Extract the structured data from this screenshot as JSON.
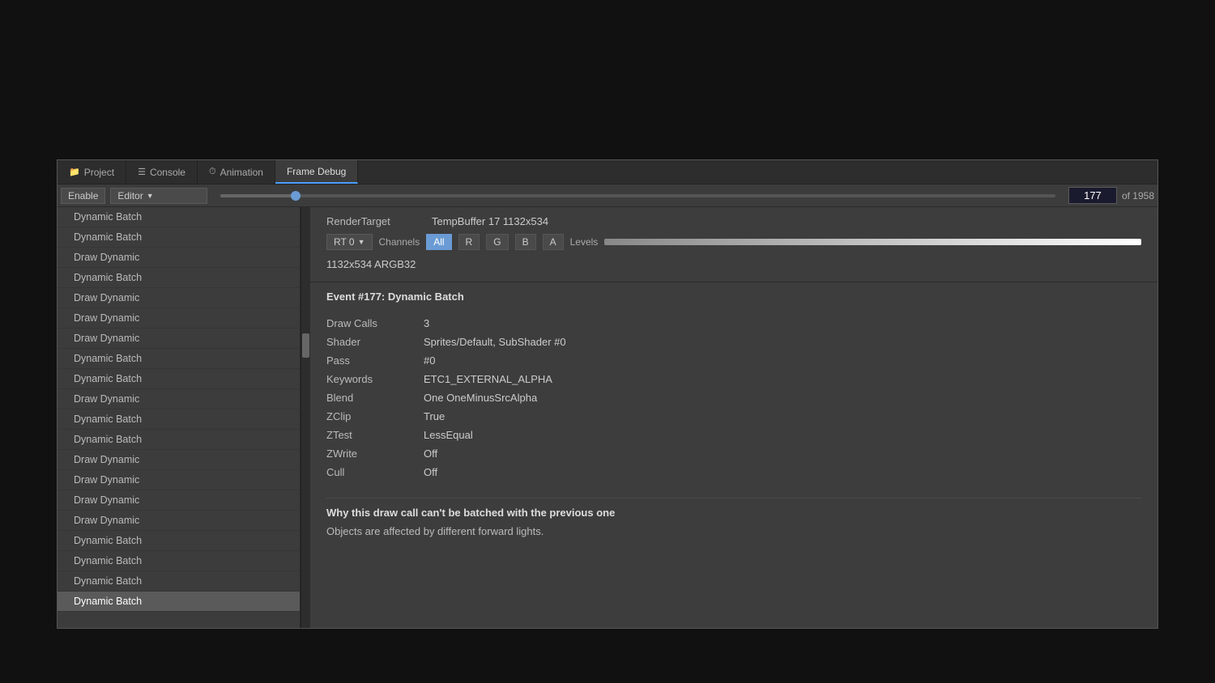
{
  "tabs": [
    {
      "id": "project",
      "label": "Project",
      "icon": "📁",
      "active": false
    },
    {
      "id": "console",
      "label": "Console",
      "icon": "☰",
      "active": false
    },
    {
      "id": "animation",
      "label": "Animation",
      "icon": "⏱",
      "active": false
    },
    {
      "id": "frame-debug",
      "label": "Frame Debug",
      "icon": "",
      "active": true
    }
  ],
  "toolbar": {
    "enable_label": "Enable",
    "editor_label": "Editor",
    "frame_number": "177",
    "of_total": "of 1958",
    "slider_percent": 9
  },
  "event_list": {
    "items": [
      {
        "label": "Dynamic Batch",
        "selected": false
      },
      {
        "label": "Dynamic Batch",
        "selected": false
      },
      {
        "label": "Draw Dynamic",
        "selected": false
      },
      {
        "label": "Dynamic Batch",
        "selected": false
      },
      {
        "label": "Draw Dynamic",
        "selected": false
      },
      {
        "label": "Draw Dynamic",
        "selected": false
      },
      {
        "label": "Draw Dynamic",
        "selected": false
      },
      {
        "label": "Dynamic Batch",
        "selected": false
      },
      {
        "label": "Dynamic Batch",
        "selected": false
      },
      {
        "label": "Draw Dynamic",
        "selected": false
      },
      {
        "label": "Dynamic Batch",
        "selected": false
      },
      {
        "label": "Dynamic Batch",
        "selected": false
      },
      {
        "label": "Draw Dynamic",
        "selected": false
      },
      {
        "label": "Draw Dynamic",
        "selected": false
      },
      {
        "label": "Draw Dynamic",
        "selected": false
      },
      {
        "label": "Draw Dynamic",
        "selected": false
      },
      {
        "label": "Dynamic Batch",
        "selected": false
      },
      {
        "label": "Dynamic Batch",
        "selected": false
      },
      {
        "label": "Dynamic Batch",
        "selected": false
      },
      {
        "label": "Dynamic Batch",
        "selected": true
      }
    ]
  },
  "details": {
    "render_target_label": "RenderTarget",
    "render_target_value": "TempBuffer 17 1132x534",
    "rt_dropdown": "RT 0",
    "channels_label": "Channels",
    "channel_buttons": [
      {
        "label": "All",
        "active": true
      },
      {
        "label": "R",
        "active": false
      },
      {
        "label": "G",
        "active": false
      },
      {
        "label": "B",
        "active": false
      },
      {
        "label": "A",
        "active": false
      }
    ],
    "levels_label": "Levels",
    "resolution_text": "1132x534 ARGB32",
    "event_title": "Event #177: Dynamic Batch",
    "properties": [
      {
        "name": "Draw Calls",
        "value": "3"
      },
      {
        "name": "Shader",
        "value": "Sprites/Default, SubShader #0"
      },
      {
        "name": "Pass",
        "value": "#0"
      },
      {
        "name": "Keywords",
        "value": "ETC1_EXTERNAL_ALPHA"
      },
      {
        "name": "Blend",
        "value": "One OneMinusSrcAlpha"
      },
      {
        "name": "ZClip",
        "value": "True"
      },
      {
        "name": "ZTest",
        "value": "LessEqual"
      },
      {
        "name": "ZWrite",
        "value": "Off"
      },
      {
        "name": "Cull",
        "value": "Off"
      }
    ],
    "batch_warning_title": "Why this draw call can't be batched with the previous one",
    "batch_warning_desc": "Objects are affected by different forward lights."
  }
}
